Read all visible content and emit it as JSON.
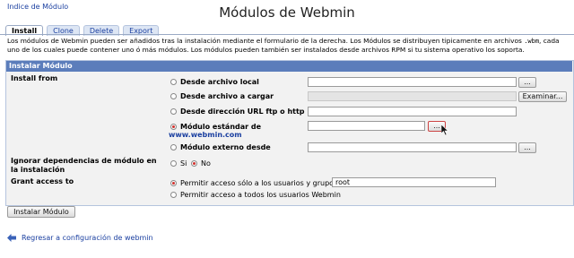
{
  "nav": {
    "top_link": "Indice de Módulo",
    "back_link": "Regresar a configuración de webmin"
  },
  "page": {
    "title": "Módulos de Webmin"
  },
  "tabs": [
    {
      "label": "Install",
      "active": true
    },
    {
      "label": "Clone",
      "active": false
    },
    {
      "label": "Delete",
      "active": false
    },
    {
      "label": "Export",
      "active": false
    }
  ],
  "description": {
    "part1": "Los módulos de Webmin pueden ser añadidos tras la instalación mediante el formulario de la derecha. Los Módulos se distribuyen tipicamente en archivos ",
    "code": ".wbm",
    "part2": ", cada uno de los cuales puede contener uno ó más módulos. Los módulos pueden también ser instalados desde archivos RPM si tu sistema operativo los soporta."
  },
  "form": {
    "header": "Instalar Módulo",
    "install_from_label": "Install from",
    "options": {
      "local": "Desde archivo local",
      "upload": "Desde archivo a cargar",
      "url": "Desde dirección URL ftp o http",
      "standard": "Módulo estándar de",
      "standard_link": "www.webmin.com",
      "third_party": "Módulo externo desde"
    },
    "browse_small": "...",
    "browse_upload": "Examinar...",
    "ignore_deps_label": "Ignorar dependencias de módulo en la instalación",
    "yes": "Si",
    "no": "No",
    "grant_label": "Grant access to",
    "grant_only": "Permitir acceso sólo a los usuarios y grupos :",
    "grant_users_value": "root",
    "grant_all": "Permitir acceso a todos los usuarios Webmin",
    "submit": "Instalar Módulo"
  },
  "colors": {
    "header_bg": "#5b7dbb",
    "link": "#1a3fa0",
    "radio_selected": "#d0312d"
  }
}
